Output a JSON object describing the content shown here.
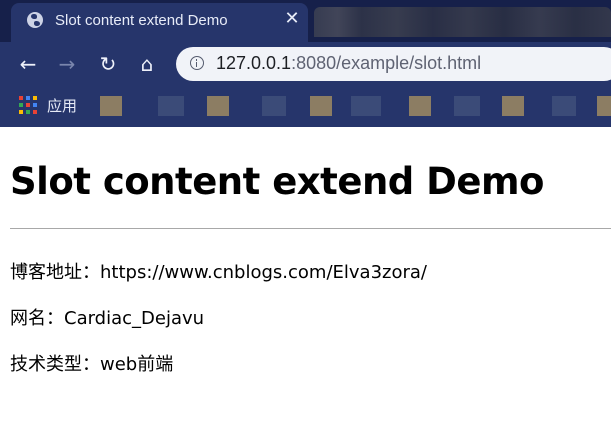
{
  "browser": {
    "tab": {
      "title": "Slot content extend Demo",
      "favicon_icon": "globe-icon",
      "close_glyph": "✕"
    },
    "toolbar": {
      "back_glyph": "←",
      "forward_glyph": "→",
      "reload_glyph": "↻",
      "home_glyph": "⌂"
    },
    "omnibox": {
      "host": "127.0.0.1",
      "rest": ":8080/example/slot.html",
      "info_icon": "info-icon"
    },
    "bookmarks": {
      "apps_label": "应用",
      "apps_icon": "apps-grid-icon"
    },
    "colors": {
      "chrome_dark": "#16204a",
      "chrome": "#26356b"
    }
  },
  "page": {
    "heading": "Slot content extend Demo",
    "lines": [
      "博客地址：https://www.cnblogs.com/Elva3zora/",
      "网名：Cardiac_Dejavu",
      "技术类型：web前端"
    ]
  }
}
